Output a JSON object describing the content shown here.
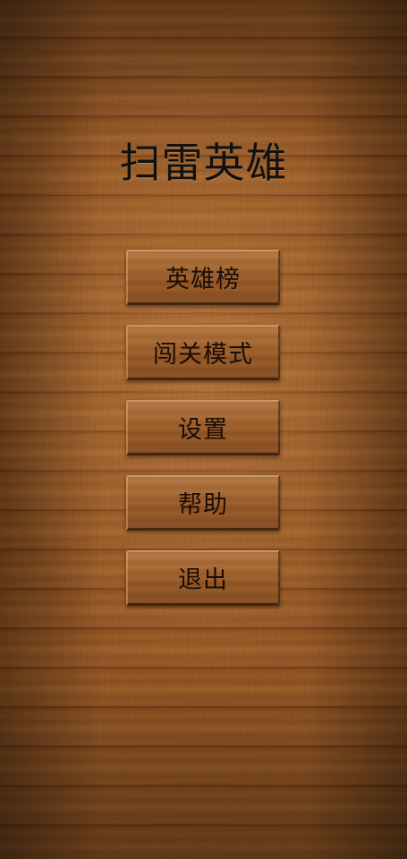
{
  "app": {
    "title": "扫雷英雄"
  },
  "menu": {
    "items": [
      {
        "label": "英雄榜"
      },
      {
        "label": "闯关模式"
      },
      {
        "label": "设置"
      },
      {
        "label": "帮助"
      },
      {
        "label": "退出"
      }
    ]
  },
  "theme": {
    "background": "wood",
    "text_color": "#111111",
    "button_wood_color": "#9b5b28"
  }
}
